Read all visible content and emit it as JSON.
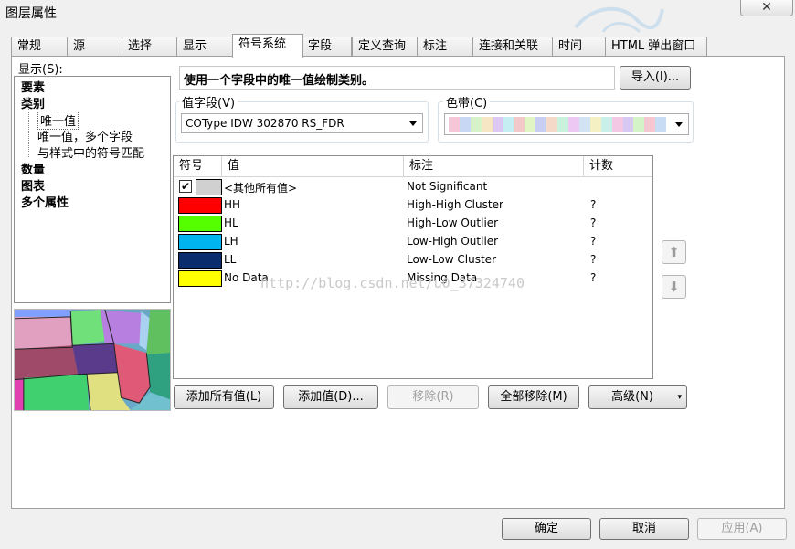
{
  "window": {
    "title": "图层属性",
    "close_icon": "close-icon"
  },
  "tabs": [
    "常规",
    "源",
    "选择",
    "显示",
    "符号系统",
    "字段",
    "定义查询",
    "标注",
    "连接和关联",
    "时间",
    "HTML 弹出窗口"
  ],
  "show": {
    "label": "显示(S):",
    "items": [
      {
        "label": "要素",
        "bold": true
      },
      {
        "label": "类别",
        "bold": true
      },
      {
        "label": "唯一值",
        "child": true,
        "selected": true
      },
      {
        "label": "唯一值，多个字段",
        "child": true
      },
      {
        "label": "与样式中的符号匹配",
        "child": true
      },
      {
        "label": "数量",
        "bold": true
      },
      {
        "label": "图表",
        "bold": true
      },
      {
        "label": "多个属性",
        "bold": true
      }
    ]
  },
  "description": "使用一个字段中的唯一值绘制类别。",
  "import_button": "导入(I)...",
  "value_field": {
    "label": "值字段(V)",
    "value": "COType IDW 302870 RS_FDR"
  },
  "color_ramp": {
    "label": "色带(C)",
    "colors": [
      "#f4c6d7",
      "#c8d8f4",
      "#d6f2c8",
      "#f7e6c4",
      "#dcc8f2",
      "#c4eef2",
      "#f2c8c8",
      "#e0f4c4",
      "#c8cdf2",
      "#f4d9c8",
      "#c8f2dc",
      "#ecc8f2",
      "#d2e4f4",
      "#f4f0c4",
      "#c8f0e8",
      "#f2c8e4",
      "#d8c8f4",
      "#d4f4c8",
      "#f4c8d0",
      "#c8dcf4"
    ]
  },
  "table": {
    "headers": [
      "符号",
      "值",
      "标注",
      "计数"
    ],
    "rows": [
      {
        "color": "#d0d0d0",
        "value": "<其他所有值>",
        "label": "Not Significant",
        "count": "",
        "checkbox": true
      },
      {
        "color": "#ff0000",
        "value": "HH",
        "label": "High-High Cluster",
        "count": "?"
      },
      {
        "color": "#55ff00",
        "value": "HL",
        "label": "High-Low Outlier",
        "count": "?"
      },
      {
        "color": "#00b4f0",
        "value": "LH",
        "label": "Low-High Outlier",
        "count": "?"
      },
      {
        "color": "#0a2d6e",
        "value": "LL",
        "label": "Low-Low Cluster",
        "count": "?"
      },
      {
        "color": "#ffff00",
        "value": "No Data",
        "label": "Missing Data",
        "count": "?"
      }
    ]
  },
  "watermark": "http://blog.csdn.net/u0_37324740",
  "buttons": {
    "add_all": "添加所有值(L)",
    "add_values": "添加值(D)...",
    "remove": "移除(R)",
    "remove_all": "全部移除(M)",
    "advanced": "高级(N)"
  },
  "footer": {
    "ok": "确定",
    "cancel": "取消",
    "apply": "应用(A)"
  }
}
